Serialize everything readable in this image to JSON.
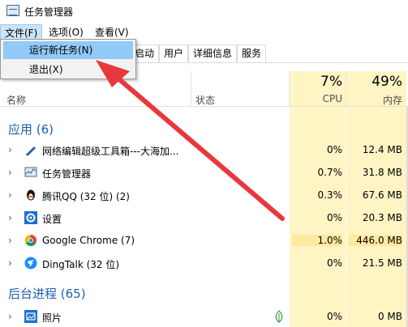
{
  "window": {
    "title": "任务管理器"
  },
  "menu": {
    "file": "文件(F)",
    "options": "选项(O)",
    "view": "查看(V)"
  },
  "file_menu": {
    "run_new_task": "运行新任务(N)",
    "exit": "退出(X)"
  },
  "tabs": {
    "startup": "启动",
    "users": "用户",
    "details": "详细信息",
    "services": "服务"
  },
  "header": {
    "name": "名称",
    "status": "状态",
    "cpu_percent": "7%",
    "cpu_label": "CPU",
    "mem_percent": "49%",
    "mem_label": "内存"
  },
  "sections": {
    "apps": "应用 (6)",
    "background": "后台进程 (65)"
  },
  "rows": [
    {
      "name": "网络编辑超级工具箱---大海加...",
      "cpu": "0%",
      "mem": "12.4 MB",
      "icon": "pen-icon"
    },
    {
      "name": "任务管理器",
      "cpu": "0.7%",
      "mem": "31.8 MB",
      "icon": "task-manager-icon"
    },
    {
      "name": "腾讯QQ (32 位) (2)",
      "cpu": "0.3%",
      "mem": "67.6 MB",
      "icon": "qq-penguin-icon"
    },
    {
      "name": "设置",
      "cpu": "0%",
      "mem": "20.3 MB",
      "icon": "gear-icon"
    },
    {
      "name": "Google Chrome (7)",
      "cpu": "1.0%",
      "mem": "446.0 MB",
      "icon": "chrome-icon"
    },
    {
      "name": "DingTalk (32 位)",
      "cpu": "0%",
      "mem": "21.5 MB",
      "icon": "dingtalk-icon"
    },
    {
      "name": "照片",
      "cpu": "0%",
      "mem": "0 MB",
      "icon": "photos-icon"
    }
  ],
  "colors": {
    "accent": "#1f5fb0",
    "highlight": "#fff4c4",
    "annotation_arrow": "#e8383d"
  }
}
